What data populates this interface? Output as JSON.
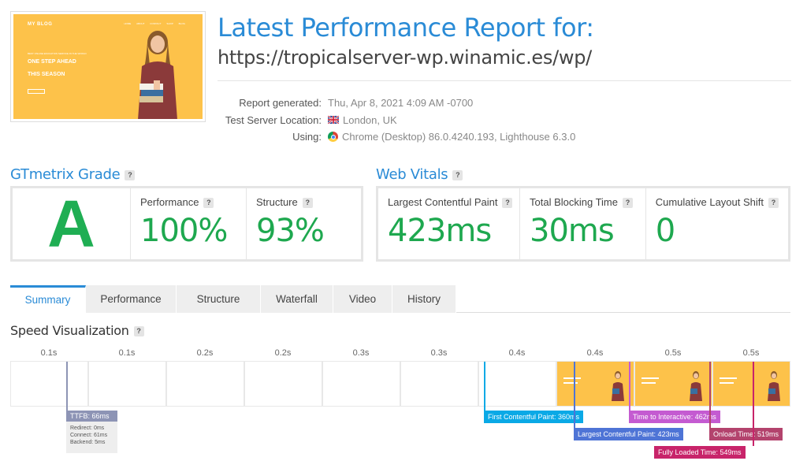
{
  "header": {
    "title": "Latest Performance Report for:",
    "url": "https://tropicalserver-wp.winamic.es/wp/"
  },
  "thumbnail": {
    "logo": "MY BLOG",
    "nav": [
      "HOME",
      "ABOUT",
      "CONTACT",
      "SHOP",
      "BLOG"
    ],
    "small": "BEST ONLINE EDUCATION SERVICE IN THE WORLD",
    "line1": "ONE STEP AHEAD",
    "line2": "THIS SEASON",
    "background": "#fdc24a"
  },
  "meta": {
    "generated_label": "Report generated:",
    "generated_value": "Thu, Apr 8, 2021 4:09 AM -0700",
    "location_label": "Test Server Location:",
    "location_value": "London, UK",
    "using_label": "Using:",
    "using_value": "Chrome (Desktop) 86.0.4240.193, Lighthouse 6.3.0"
  },
  "grade": {
    "title": "GTmetrix Grade",
    "letter": "A",
    "performance_label": "Performance",
    "performance_value": "100%",
    "structure_label": "Structure",
    "structure_value": "93%"
  },
  "vitals": {
    "title": "Web Vitals",
    "lcp_label": "Largest Contentful Paint",
    "lcp_value": "423ms",
    "tbt_label": "Total Blocking Time",
    "tbt_value": "30ms",
    "cls_label": "Cumulative Layout Shift",
    "cls_value": "0"
  },
  "help_glyph": "?",
  "tabs": [
    "Summary",
    "Performance",
    "Structure",
    "Waterfall",
    "Video",
    "History"
  ],
  "active_tab": "Summary",
  "speed": {
    "title": "Speed Visualization",
    "time_labels": [
      "0.1s",
      "0.1s",
      "0.2s",
      "0.2s",
      "0.3s",
      "0.3s",
      "0.4s",
      "0.4s",
      "0.5s",
      "0.5s"
    ],
    "ttfb": {
      "label": "TTFB: 66ms",
      "redirect": "Redirect: 0ms",
      "connect": "Connect: 61ms",
      "backend": "Backend: 5ms"
    },
    "markers": {
      "fcp": "First Contentful Paint: 360ms",
      "lcp": "Largest Contentful Paint: 423ms",
      "tti": "Time to Interactive: 462ms",
      "onload": "Onload Time: 519ms",
      "fully": "Fully Loaded Time: 549ms"
    }
  },
  "colors": {
    "accent": "#2a8bd6",
    "grade_green": "#1fae53",
    "ttfb": "#8d94b5",
    "fcp": "#0aa9e6",
    "lcp": "#4e74d6",
    "tti": "#c45bd1",
    "onload": "#b3436d",
    "fully": "#c8246a"
  }
}
